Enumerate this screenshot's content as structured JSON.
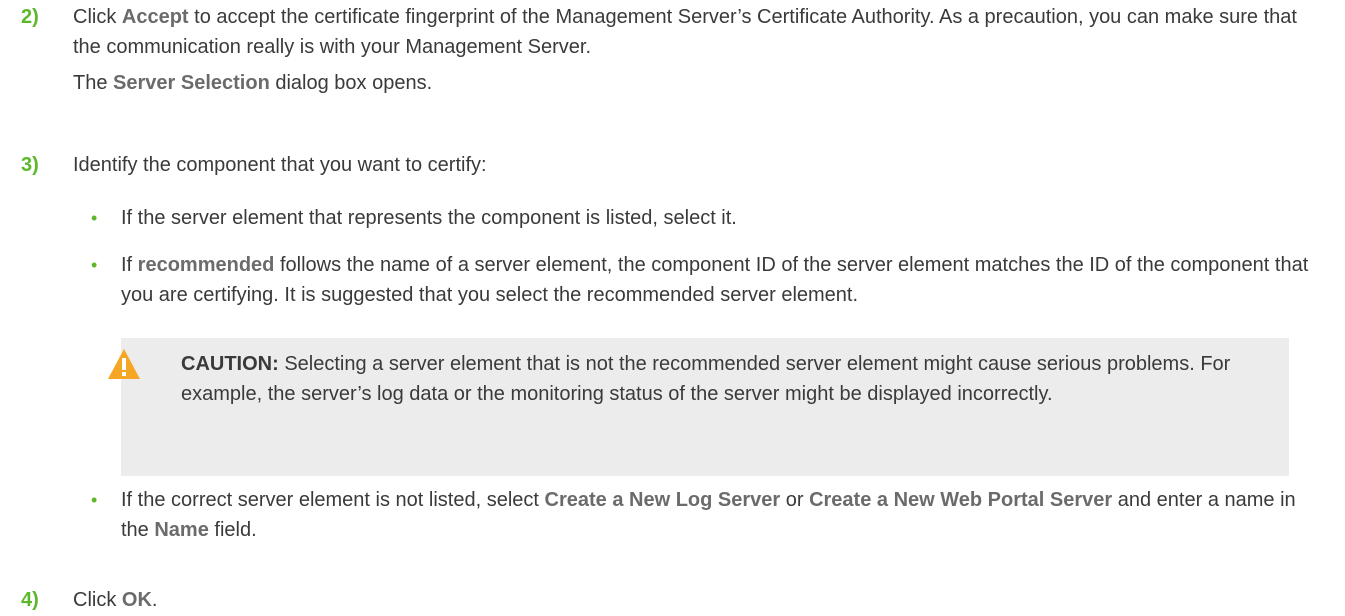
{
  "step2": {
    "number": "2)",
    "t1": "Click ",
    "b1": "Accept",
    "t2": " to accept the certificate fingerprint of the Management Server’s Certificate Authority. As a precaution, you can make sure that the communication really is with your Management Server.",
    "r1": "The ",
    "rb": "Server Selection",
    "r2": " dialog box opens."
  },
  "step3": {
    "number": "3)",
    "text": "Identify the component that you want to certify:",
    "bullet1": "If the server element that represents the component is listed, select it.",
    "bullet2": {
      "b": "recommended",
      "t1": "If ",
      "t2": " follows the name of a server element, the component ID of the server element matches the ID of the component that you are certifying. It is suggested that you select the recommended server element."
    },
    "caution": {
      "label": "CAUTION:",
      "text": "  Selecting a server element that is not the recommended server element might cause serious problems. For example, the server’s log data or the monitoring status of the server might be displayed incorrectly."
    },
    "bullet3": {
      "t1": "If the correct server element is not listed, select ",
      "b1": "Create a New Log Server",
      "t2": " or ",
      "b2": "Create a New Web Portal Server",
      "t3": " and enter a name in the ",
      "b3": "Name",
      "t4": " field."
    }
  },
  "step4": {
    "number": "4)",
    "t1": "Click ",
    "b1": "OK",
    "t2": "."
  },
  "bullet_glyph": "•",
  "icons": {
    "caution": "warning-triangle-icon"
  },
  "colors": {
    "accent": "#5cb82a",
    "warning": "#f5a623",
    "callout_bg": "#ececec"
  }
}
